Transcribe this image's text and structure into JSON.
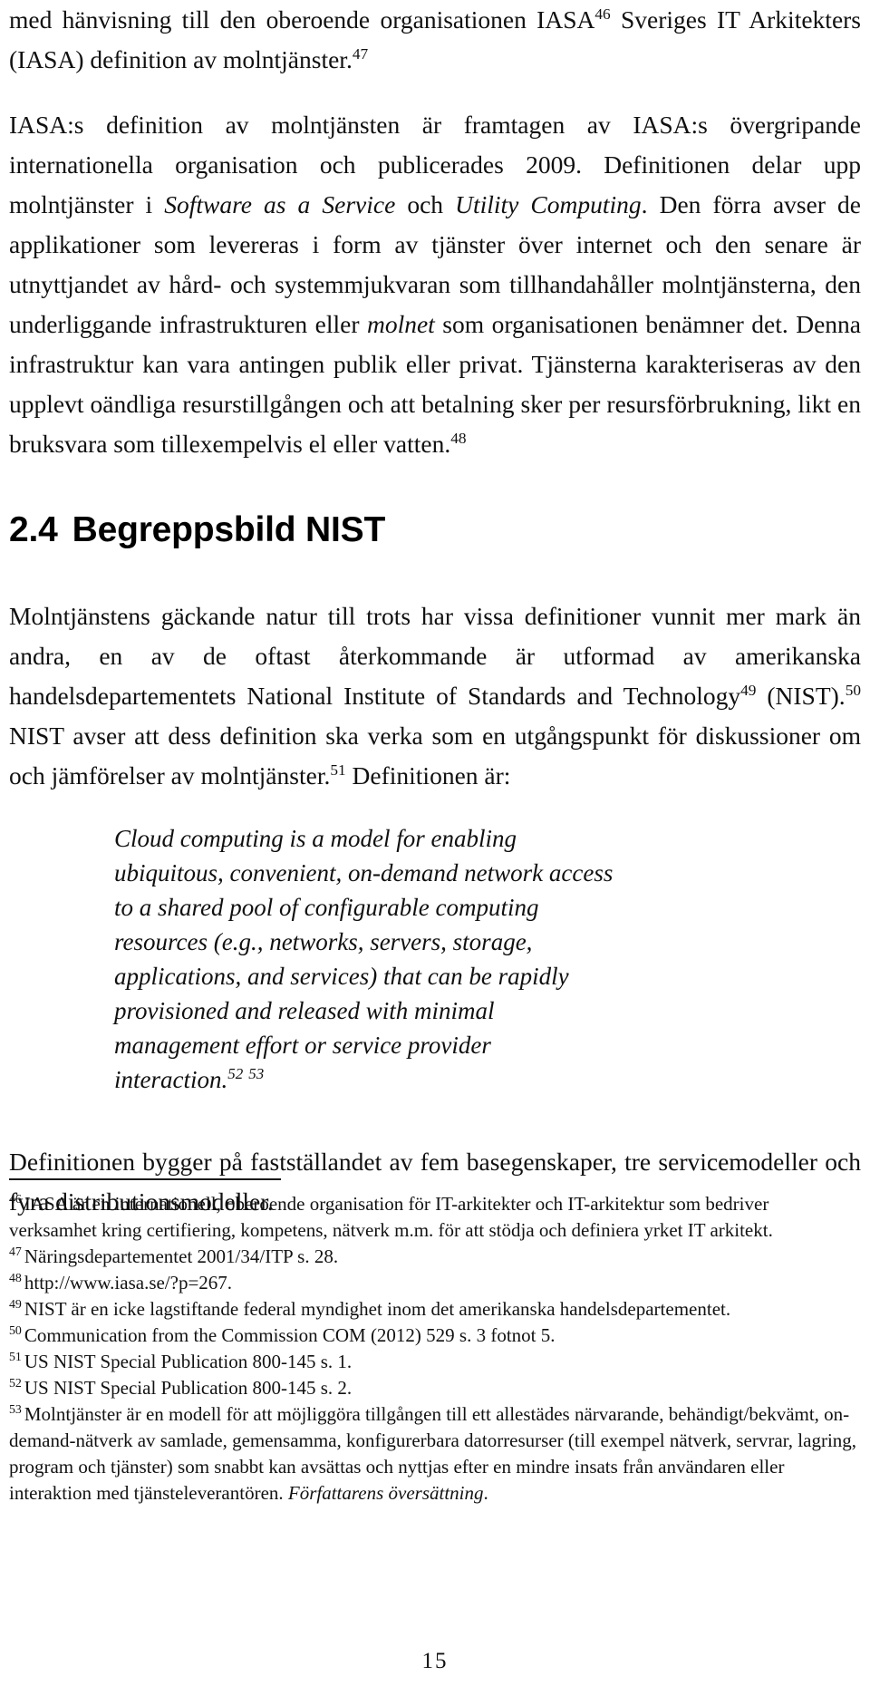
{
  "document": {
    "page_number": "15",
    "language": "sv"
  },
  "body": {
    "para1": {
      "text_before_sup1": "med hänvisning till den oberoende organisationen IASA",
      "sup1": "46",
      "text_after_sup1": " Sveriges IT Arkitekters (IASA) definition av molntjänster.",
      "sup2": "47"
    },
    "para2": {
      "seg1": "IASA:s definition av molntjänsten är framtagen av IASA:s övergripande internationella organisation och publicerades 2009. Definitionen delar upp molntjänster i ",
      "italic1": "Software as a Service",
      "seg2": " och ",
      "italic2": "Utility Computing",
      "seg3": ". Den förra avser de applikationer som levereras i form av tjänster över internet och den senare är utnyttjandet av hård- och systemmjukvaran som tillhandahåller molntjänsterna, den underliggande infrastrukturen eller ",
      "italic3": "molnet",
      "seg4": " som organisationen benämner det. Denna infrastruktur kan vara antingen publik eller privat. Tjänsterna karakteriseras av den upplevt oändliga resurstillgången och att betalning sker per resursförbrukning, likt en bruksvara som tillexempelvis el eller vatten.",
      "sup1": "48"
    },
    "heading": {
      "number": "2.4",
      "title": "Begreppsbild NIST"
    },
    "para3": {
      "seg1": "Molntjänstens gäckande natur till trots har vissa definitioner vunnit mer mark än andra, en av de oftast återkommande är utformad av amerikanska handelsdepartementets National Institute of Standards and Technology",
      "sup1": "49",
      "seg2": " (NIST).",
      "sup2": "50",
      "seg3": " NIST avser att dess definition ska verka som en utgångspunkt för diskussioner om och jämförelser av molntjänster.",
      "sup3": "51",
      "seg4": " Definitionen är:"
    },
    "quote": {
      "lines": [
        "Cloud computing is a model for enabling",
        "ubiquitous, convenient, on-demand network access",
        "to a shared pool of configurable computing",
        "resources (e.g., networks, servers, storage,",
        "applications, and services) that can be rapidly",
        "provisioned and released with minimal",
        "management effort or service provider",
        "interaction."
      ],
      "sup1": "52",
      "sup2": "53"
    },
    "para4": {
      "text": "Definitionen bygger på fastställandet av fem basegenskaper, tre servicemodeller och fyra distributionsmodeller."
    }
  },
  "footnotes": [
    {
      "mark": "46",
      "text": "IASA är en internationell, oberoende organisation för IT-arkitekter och IT-arkitektur som bedriver verksamhet kring certifiering, kompetens, nätverk m.m. för att stödja och definiera yrket IT arkitekt."
    },
    {
      "mark": "47",
      "text": "Näringsdepartementet 2001/34/ITP s. 28."
    },
    {
      "mark": "48",
      "text": "http://www.iasa.se/?p=267."
    },
    {
      "mark": "49",
      "text": "NIST är en icke lagstiftande federal myndighet inom det amerikanska handelsdepartementet."
    },
    {
      "mark": "50",
      "text": "Communication from the Commission COM (2012) 529 s. 3 fotnot 5."
    },
    {
      "mark": "51",
      "text": "US NIST Special Publication 800-145 s. 1."
    },
    {
      "mark": "52",
      "text": "US NIST Special Publication 800-145 s. 2."
    },
    {
      "mark": "53",
      "text_main": "Molntjänster är en modell för att möjliggöra tillgången till ett allestädes närvarande, behändigt/bekvämt, on-demand-nätverk av samlade, gemensamma, konfigurerbara datorresurser (till exempel nätverk, servrar, lagring, program och tjänster) som snabbt kan avsättas och nyttjas efter en mindre insats från användaren eller interaktion med tjänsteleverantören. ",
      "text_italic": "Författarens översättning",
      "text_tail": "."
    }
  ]
}
